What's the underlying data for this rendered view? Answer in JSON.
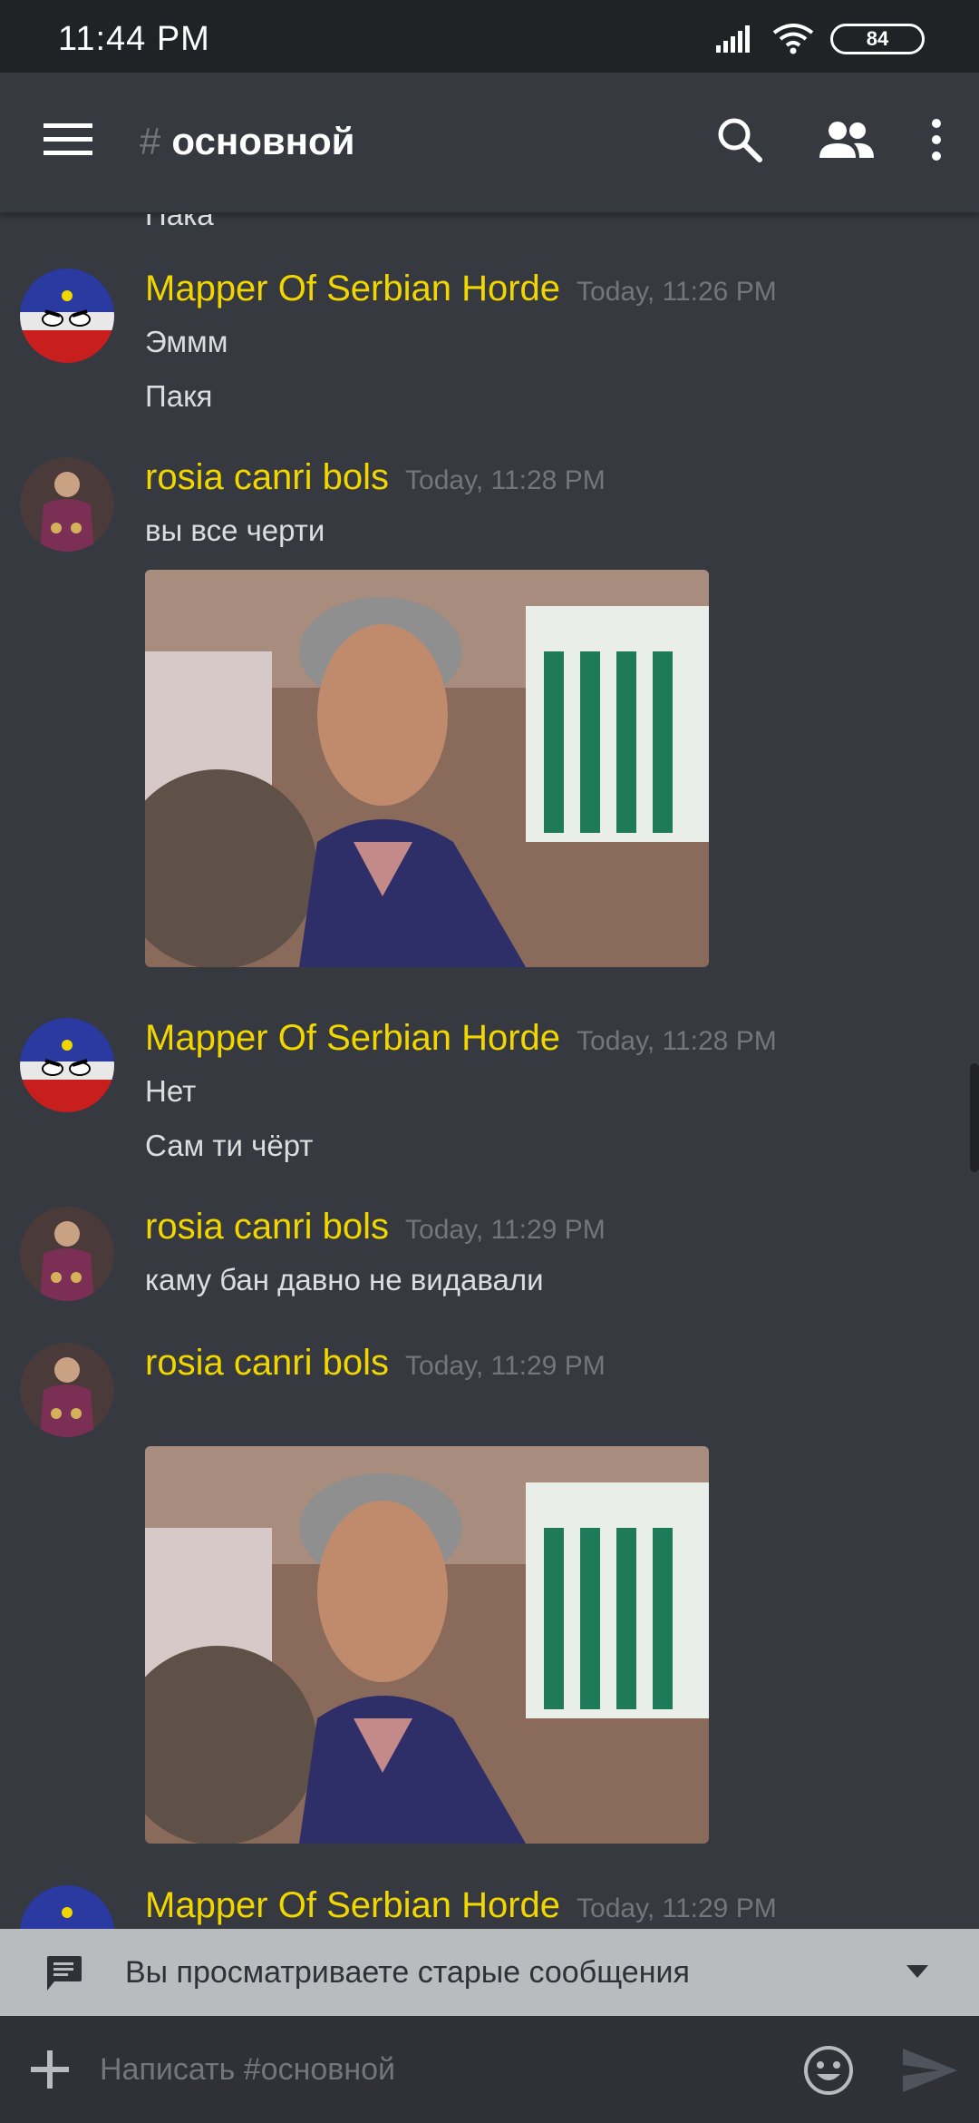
{
  "status_bar": {
    "time": "11:44 PM",
    "battery": "84"
  },
  "header": {
    "channel_hash": "#",
    "channel_name": "основной"
  },
  "top_partial_text": "Пака",
  "messages": [
    {
      "author": "Mapper Of Serbian Horde",
      "time": "Today, 11:26 PM",
      "lines": [
        "Эммм",
        "Пакя"
      ]
    },
    {
      "author": "rosia canri bols",
      "time": "Today, 11:28 PM",
      "lines": [
        "вы все черти"
      ],
      "attachment": "photo"
    },
    {
      "author": "Mapper Of Serbian Horde",
      "time": "Today, 11:28 PM",
      "lines": [
        "Нет",
        "Сам ти чёрт"
      ]
    },
    {
      "author": "rosia canri bols",
      "time": "Today, 11:29 PM",
      "lines": [
        "каму бан давно не видавали"
      ]
    },
    {
      "author": "rosia canri bols",
      "time": "Today, 11:29 PM",
      "lines": [],
      "attachment": "photo"
    },
    {
      "author": "Mapper Of Serbian Horde",
      "time": "Today, 11:29 PM",
      "lines": []
    }
  ],
  "old_messages_bar": {
    "text": "Вы просматриваете старые сообщения"
  },
  "composer": {
    "placeholder": "Написать #основной"
  },
  "colors": {
    "author": "#f1d600",
    "background": "#36393f",
    "timestamp": "#72767d"
  },
  "icons": [
    "hamburger-menu-icon",
    "search-icon",
    "members-icon",
    "more-vertical-icon",
    "chat-bubble-icon",
    "chevron-down-icon",
    "plus-icon",
    "emoji-icon",
    "send-icon"
  ]
}
